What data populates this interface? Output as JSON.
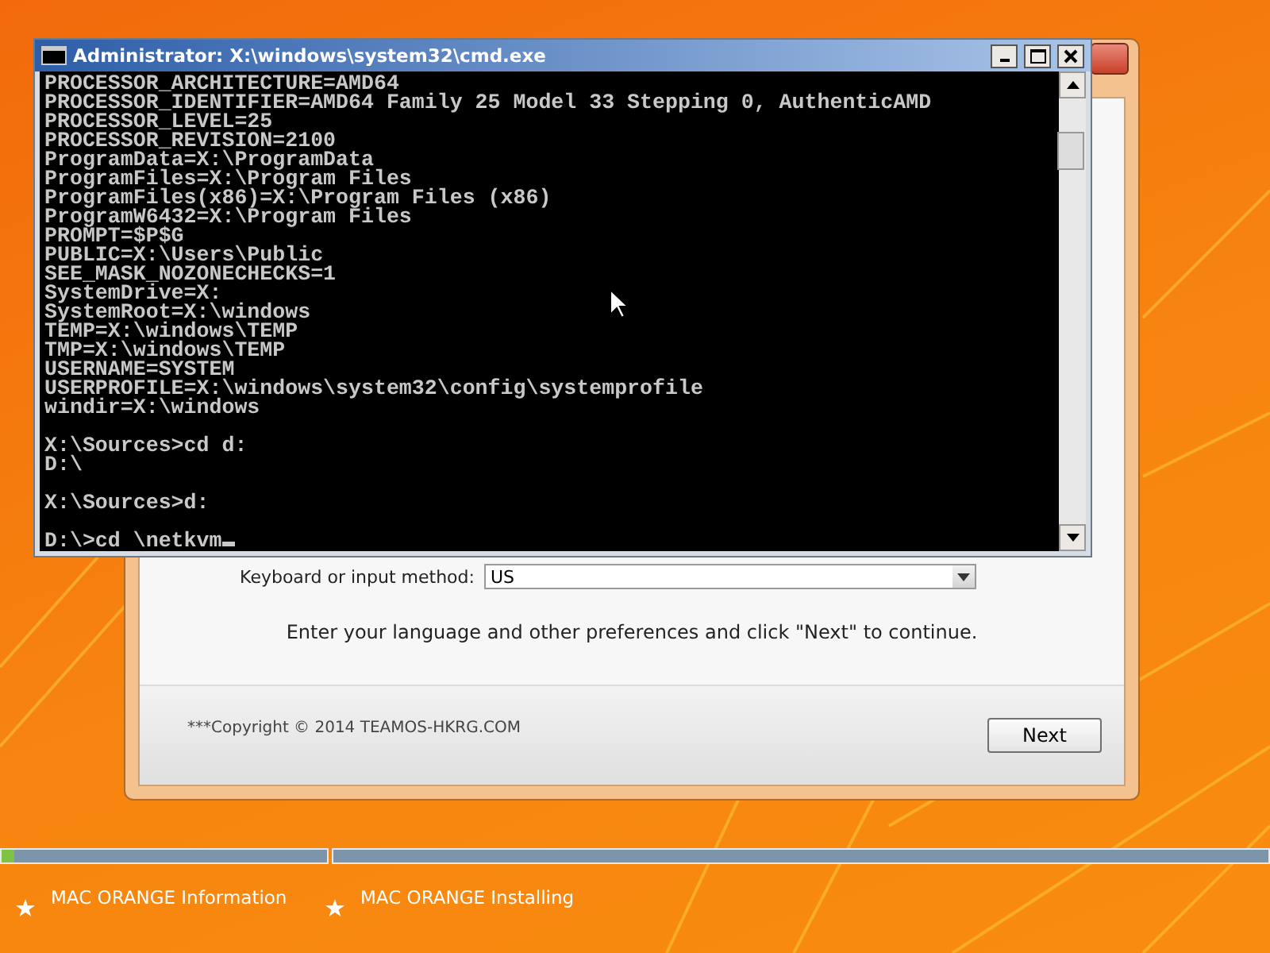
{
  "setup_window": {
    "keyboard_label": "Keyboard or input method:",
    "keyboard_value": "US",
    "instruction": "Enter your language and other preferences and click \"Next\" to continue.",
    "copyright": "***Copyright © 2014 TEAMOS-HKRG.COM",
    "next_button": "Next"
  },
  "cmd_window": {
    "title": "Administrator: X:\\windows\\system32\\cmd.exe",
    "blocks": [
      [
        "PROCESSOR_ARCHITECTURE=AMD64",
        "PROCESSOR_IDENTIFIER=AMD64 Family 25 Model 33 Stepping 0, AuthenticAMD",
        "PROCESSOR_LEVEL=25",
        "PROCESSOR_REVISION=2100",
        "ProgramData=X:\\ProgramData",
        "ProgramFiles=X:\\Program Files",
        "ProgramFiles(x86)=X:\\Program Files (x86)",
        "ProgramW6432=X:\\Program Files",
        "PROMPT=$P$G",
        "PUBLIC=X:\\Users\\Public",
        "SEE_MASK_NOZONECHECKS=1",
        "SystemDrive=X:",
        "SystemRoot=X:\\windows",
        "TEMP=X:\\windows\\TEMP",
        "TMP=X:\\windows\\TEMP",
        "USERNAME=SYSTEM",
        "USERPROFILE=X:\\windows\\system32\\config\\systemprofile",
        "windir=X:\\windows"
      ],
      [
        "X:\\Sources>cd d:",
        "D:\\"
      ],
      [
        "X:\\Sources>d:"
      ],
      [
        "D:\\>cd \\netkvm"
      ]
    ]
  },
  "progress": {
    "level": 0.04
  },
  "steps": [
    {
      "label": "MAC ORANGE Information"
    },
    {
      "label": "MAC ORANGE Installing"
    }
  ]
}
